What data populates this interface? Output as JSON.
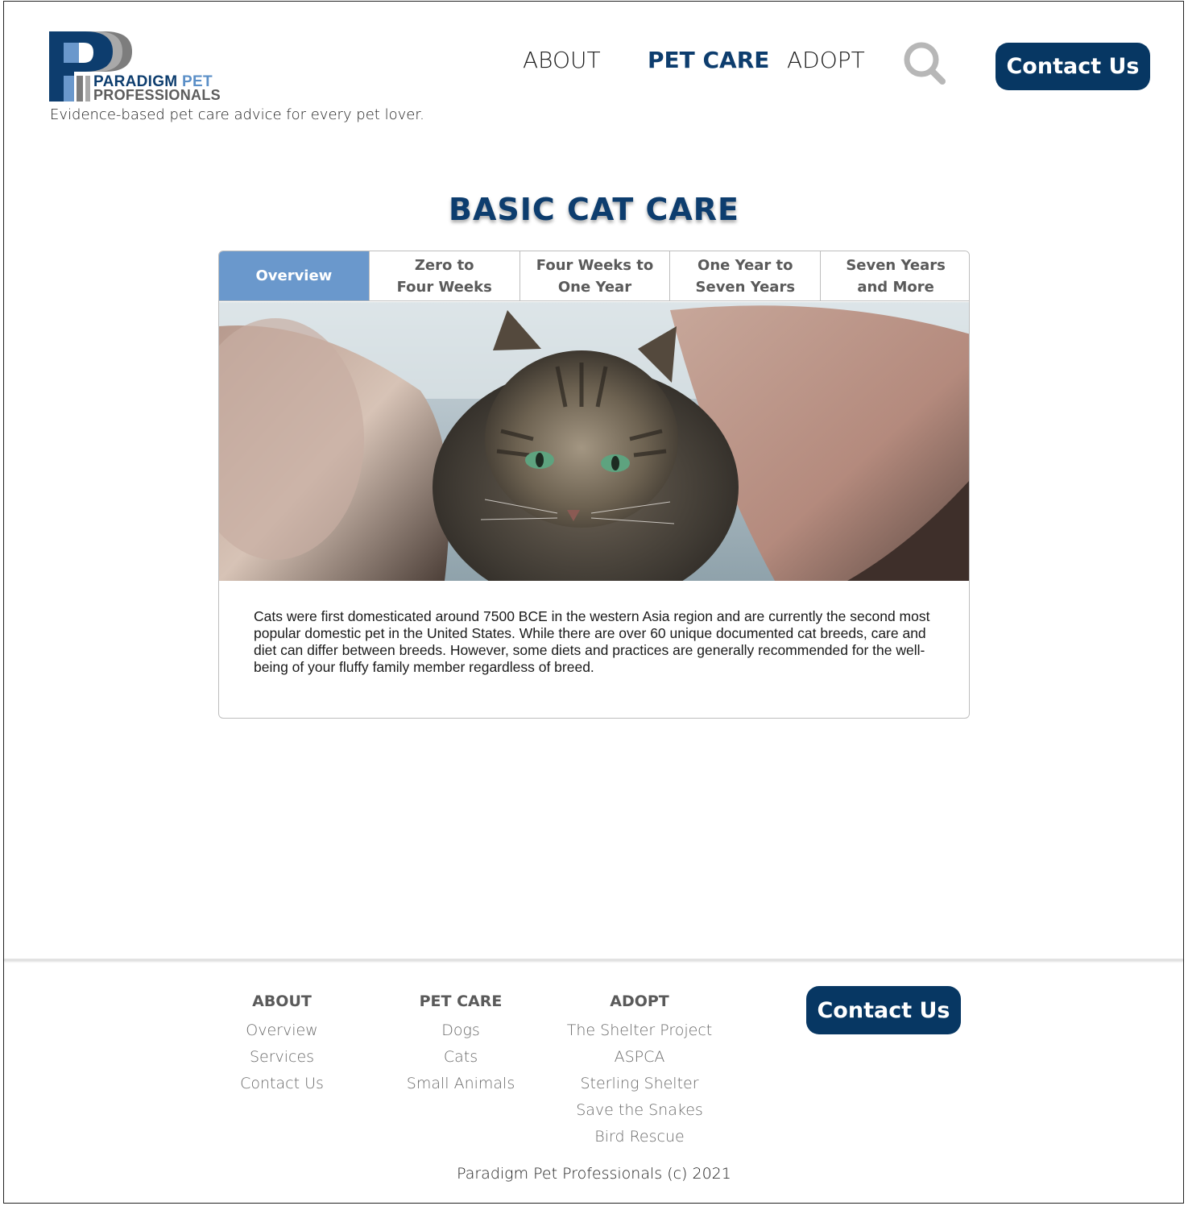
{
  "brand": {
    "name_line1": "PARADIGM",
    "name_line1_accent": "PET",
    "name_line2": "PROFESSIONALS",
    "tagline": "Evidence-based pet care advice for every pet lover.",
    "colors": {
      "navy": "#0d3d6e",
      "light_blue": "#6a98cc",
      "gray": "#5c5c5c"
    }
  },
  "nav": {
    "items": [
      {
        "label": "ABOUT",
        "active": false
      },
      {
        "label": "PET CARE",
        "active": true
      },
      {
        "label": "ADOPT",
        "active": false
      }
    ],
    "search_icon": "search-icon",
    "contact_label": "Contact Us"
  },
  "main": {
    "title": "BASIC CAT CARE",
    "tabs": [
      {
        "label": "Overview",
        "active": true
      },
      {
        "label": "Zero to\nFour Weeks",
        "active": false
      },
      {
        "label": "Four Weeks to\nOne Year",
        "active": false
      },
      {
        "label": "One Year to\nSeven Years",
        "active": false
      },
      {
        "label": "Seven Years\nand More",
        "active": false
      }
    ],
    "body": "Cats were first domesticated around 7500 BCE in the western Asia region and are currently the second most popular domestic pet in the United States. While there are over 60 unique documented cat breeds, care and diet can differ between breeds. However, some diets and practices are generally recommended for the well-being of your fluffy family member regardless of breed."
  },
  "footer": {
    "columns": [
      {
        "heading": "ABOUT",
        "links": [
          "Overview",
          "Services",
          "Contact Us"
        ]
      },
      {
        "heading": "PET CARE",
        "links": [
          "Dogs",
          "Cats",
          "Small Animals"
        ]
      },
      {
        "heading": "ADOPT",
        "links": [
          "The Shelter Project",
          "ASPCA",
          "Sterling Shelter",
          "Save the Snakes",
          "Bird Rescue"
        ]
      }
    ],
    "contact_label": "Contact Us",
    "copyright": "Paradigm Pet Professionals (c) 2021"
  }
}
